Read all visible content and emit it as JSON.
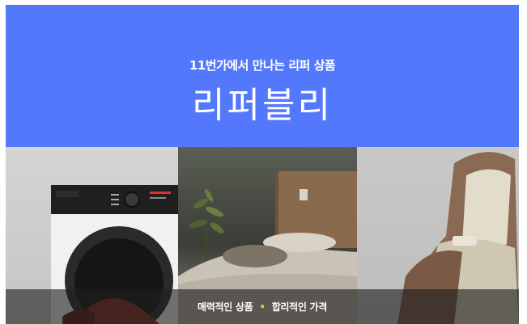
{
  "banner": {
    "subtitle": "11번가에서 만나는 리퍼 상품",
    "title": "리퍼블리",
    "footer": {
      "left_text": "매력적인 상품",
      "separator": "•",
      "right_text": "합리적인 가격"
    },
    "colors": {
      "hero_background": "#5478fb",
      "separator_dot": "#f2c12e"
    },
    "photos": [
      "washing-machine",
      "bedroom-bed",
      "massage-chair"
    ]
  }
}
